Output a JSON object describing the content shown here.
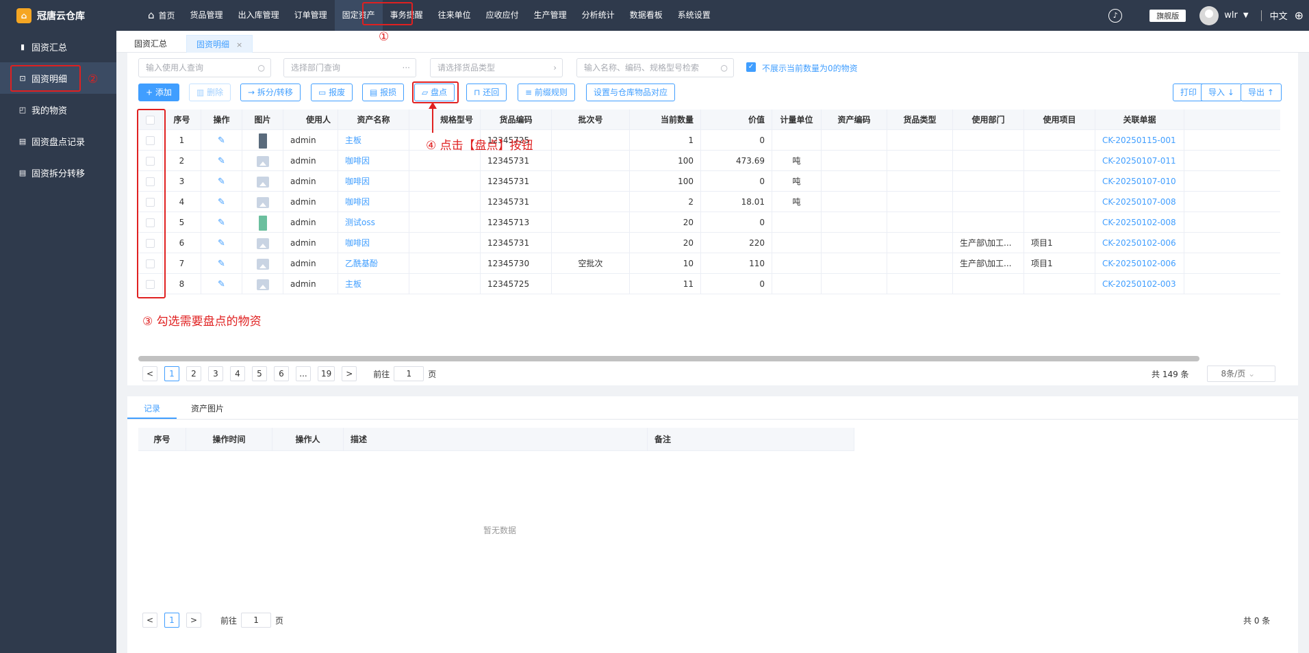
{
  "app": {
    "logo_text": "冠唐云仓库",
    "logo_icon": "warehouse-logo-icon"
  },
  "nav": [
    {
      "label": "首页",
      "icon": "home-icon"
    },
    {
      "label": "货品管理"
    },
    {
      "label": "出入库管理"
    },
    {
      "label": "订单管理"
    },
    {
      "label": "固定资产",
      "active": true
    },
    {
      "label": "事务提醒"
    },
    {
      "label": "往来单位"
    },
    {
      "label": "应收应付"
    },
    {
      "label": "生产管理"
    },
    {
      "label": "分析统计"
    },
    {
      "label": "数据看板"
    },
    {
      "label": "系统设置"
    }
  ],
  "topright": {
    "edition": "旗舰版",
    "user": "wlr",
    "lang": "中文"
  },
  "sidebar": [
    {
      "label": "固资汇总",
      "icon": "bar-chart-icon"
    },
    {
      "label": "固资明细",
      "icon": "cart-icon",
      "active": true
    },
    {
      "label": "我的物资",
      "icon": "bag-icon"
    },
    {
      "label": "固资盘点记录",
      "icon": "clipboard-icon"
    },
    {
      "label": "固资拆分转移",
      "icon": "clipboard-icon"
    }
  ],
  "tabs": [
    {
      "label": "固资汇总"
    },
    {
      "label": "固资明细",
      "active": true,
      "close": "×"
    }
  ],
  "filters": {
    "user": "输入使用人查询",
    "dept": "选择部门查询",
    "goods_type": "请选择货品类型",
    "keyword": "输入名称、编码、规格型号检索",
    "hide_zero": "不展示当前数量为0的物资"
  },
  "toolbar": {
    "add": "+ 添加",
    "delete": "删除",
    "split": "拆分/转移",
    "scrap": "报废",
    "loss": "报损",
    "inventory": "盘点",
    "return": "还回",
    "prefix": "前缀规则",
    "mapping": "设置与仓库物品对应",
    "print": "打印",
    "import": "导入",
    "export": "导出"
  },
  "table": {
    "columns": [
      "序号",
      "操作",
      "图片",
      "使用人",
      "资产名称",
      "规格型号",
      "货品编码",
      "批次号",
      "当前数量",
      "价值",
      "计量单位",
      "资产编码",
      "货品类型",
      "使用部门",
      "使用项目",
      "关联单据"
    ],
    "rows": [
      {
        "no": "1",
        "user": "admin",
        "name": "主板",
        "spec": "",
        "code": "12345725",
        "batch": "",
        "qty": "1",
        "value": "0",
        "unit": "",
        "asset_code": "",
        "type": "",
        "dept": "",
        "project": "",
        "ref": "CK-20250115-001",
        "img": "thumb-dark"
      },
      {
        "no": "2",
        "user": "admin",
        "name": "咖啡因",
        "spec": "",
        "code": "12345731",
        "batch": "",
        "qty": "100",
        "value": "473.69",
        "unit": "吨",
        "asset_code": "",
        "type": "",
        "dept": "",
        "project": "",
        "ref": "CK-20250107-011",
        "img": "placeholder"
      },
      {
        "no": "3",
        "user": "admin",
        "name": "咖啡因",
        "spec": "",
        "code": "12345731",
        "batch": "",
        "qty": "100",
        "value": "0",
        "unit": "吨",
        "asset_code": "",
        "type": "",
        "dept": "",
        "project": "",
        "ref": "CK-20250107-010",
        "img": "placeholder"
      },
      {
        "no": "4",
        "user": "admin",
        "name": "咖啡因",
        "spec": "",
        "code": "12345731",
        "batch": "",
        "qty": "2",
        "value": "18.01",
        "unit": "吨",
        "asset_code": "",
        "type": "",
        "dept": "",
        "project": "",
        "ref": "CK-20250107-008",
        "img": "placeholder"
      },
      {
        "no": "5",
        "user": "admin",
        "name": "测试oss",
        "spec": "",
        "code": "12345713",
        "batch": "",
        "qty": "20",
        "value": "0",
        "unit": "",
        "asset_code": "",
        "type": "",
        "dept": "",
        "project": "",
        "ref": "CK-20250102-008",
        "img": "thumb-green"
      },
      {
        "no": "6",
        "user": "admin",
        "name": "咖啡因",
        "spec": "",
        "code": "12345731",
        "batch": "",
        "qty": "20",
        "value": "220",
        "unit": "",
        "asset_code": "",
        "type": "",
        "dept": "生产部\\加工...",
        "project": "项目1",
        "ref": "CK-20250102-006",
        "img": "placeholder"
      },
      {
        "no": "7",
        "user": "admin",
        "name": "乙酰基酚",
        "spec": "",
        "code": "12345730",
        "batch": "空批次",
        "qty": "10",
        "value": "110",
        "unit": "",
        "asset_code": "",
        "type": "",
        "dept": "生产部\\加工...",
        "project": "项目1",
        "ref": "CK-20250102-006",
        "img": "placeholder"
      },
      {
        "no": "8",
        "user": "admin",
        "name": "主板",
        "spec": "",
        "code": "12345725",
        "batch": "",
        "qty": "11",
        "value": "0",
        "unit": "",
        "asset_code": "",
        "type": "",
        "dept": "",
        "project": "",
        "ref": "CK-20250102-003",
        "img": "placeholder"
      }
    ]
  },
  "pager": {
    "pages": [
      "1",
      "2",
      "3",
      "4",
      "5",
      "6",
      "...",
      "19"
    ],
    "prev": "<",
    "next": ">",
    "goto_label": "前往",
    "goto_value": "1",
    "page_unit": "页",
    "total": "共 149 条",
    "size": "8条/页"
  },
  "bottom_tabs": [
    "记录",
    "资产图片"
  ],
  "record_table": {
    "columns": [
      "序号",
      "操作时间",
      "操作人",
      "描述",
      "备注"
    ],
    "empty": "暂无数据"
  },
  "bottom_pager": {
    "page": "1",
    "goto_label": "前往",
    "goto_value": "1",
    "page_unit": "页",
    "total": "共 0 条"
  },
  "annotations": {
    "a1": "①",
    "a2": "②",
    "a3": "③ 勾选需要盘点的物资",
    "a4": "④ 点击【盘点】按钮",
    "color": "#e02020"
  }
}
